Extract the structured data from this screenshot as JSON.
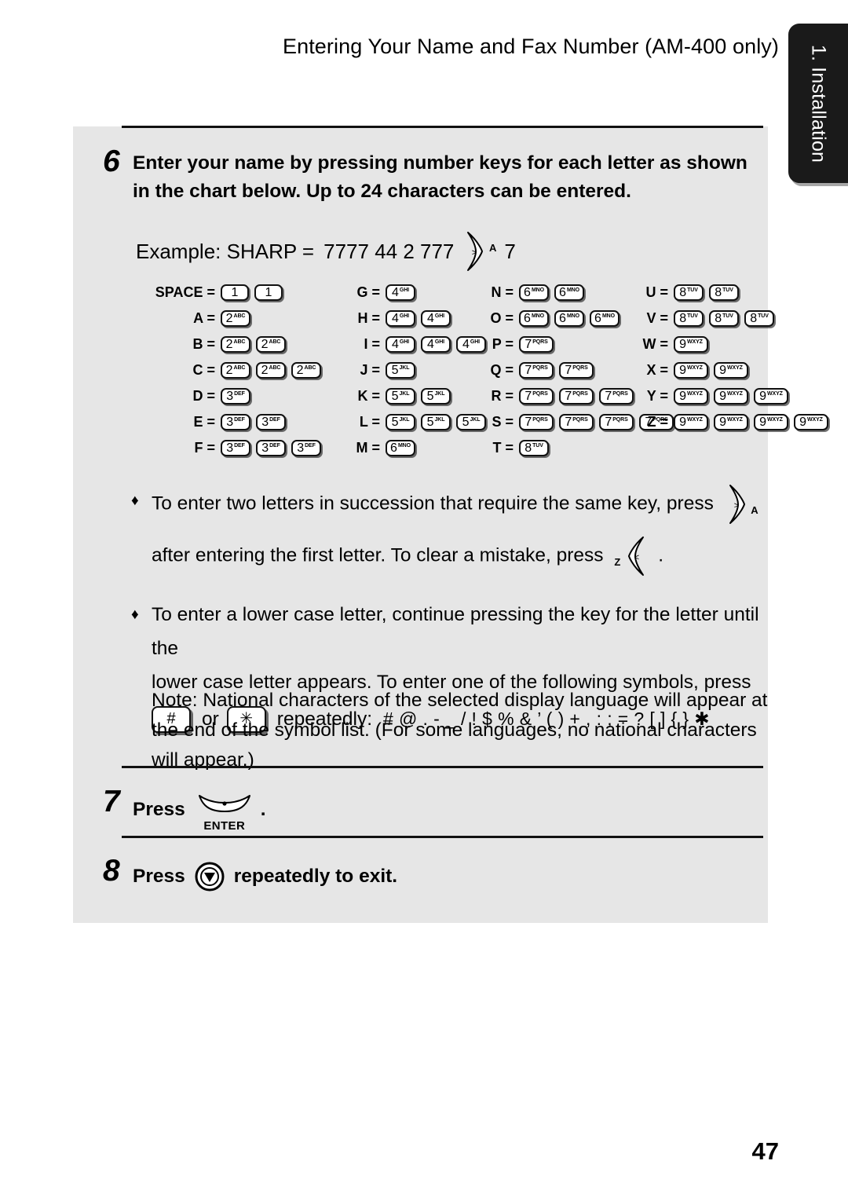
{
  "header": {
    "title": "Entering Your Name and Fax Number (AM-400 only)"
  },
  "side_tab": {
    "label": "1. Installation"
  },
  "steps": [
    {
      "number": "6",
      "text": "Enter your name by pressing number keys for each letter as shown in the chart below. Up to 24 characters can be entered."
    },
    {
      "number": "7",
      "press_label": "Press",
      "key_label": "ENTER",
      "trailing": "."
    },
    {
      "number": "8",
      "press_label": "Press",
      "after_text": "repeatedly to exit."
    }
  ],
  "example": {
    "prefix": "Example: SHARP =",
    "digits": "7777  44  2  777",
    "key_sup": "A",
    "suffix": "7"
  },
  "chart": {
    "columns": [
      {
        "rows": [
          {
            "label": "SPACE =",
            "keys": [
              {
                "digit": "1",
                "letters": ""
              },
              {
                "digit": "1",
                "letters": ""
              }
            ]
          },
          {
            "label": "A =",
            "keys": [
              {
                "digit": "2",
                "letters": "ABC"
              }
            ]
          },
          {
            "label": "B =",
            "keys": [
              {
                "digit": "2",
                "letters": "ABC"
              },
              {
                "digit": "2",
                "letters": "ABC"
              }
            ]
          },
          {
            "label": "C =",
            "keys": [
              {
                "digit": "2",
                "letters": "ABC"
              },
              {
                "digit": "2",
                "letters": "ABC"
              },
              {
                "digit": "2",
                "letters": "ABC"
              }
            ]
          },
          {
            "label": "D =",
            "keys": [
              {
                "digit": "3",
                "letters": "DEF"
              }
            ]
          },
          {
            "label": "E =",
            "keys": [
              {
                "digit": "3",
                "letters": "DEF"
              },
              {
                "digit": "3",
                "letters": "DEF"
              }
            ]
          },
          {
            "label": "F =",
            "keys": [
              {
                "digit": "3",
                "letters": "DEF"
              },
              {
                "digit": "3",
                "letters": "DEF"
              },
              {
                "digit": "3",
                "letters": "DEF"
              }
            ]
          }
        ]
      },
      {
        "rows": [
          {
            "label": "G =",
            "keys": [
              {
                "digit": "4",
                "letters": "GHI"
              }
            ]
          },
          {
            "label": "H =",
            "keys": [
              {
                "digit": "4",
                "letters": "GHI"
              },
              {
                "digit": "4",
                "letters": "GHI"
              }
            ]
          },
          {
            "label": "I =",
            "keys": [
              {
                "digit": "4",
                "letters": "GHI"
              },
              {
                "digit": "4",
                "letters": "GHI"
              },
              {
                "digit": "4",
                "letters": "GHI"
              }
            ]
          },
          {
            "label": "J =",
            "keys": [
              {
                "digit": "5",
                "letters": "JKL"
              }
            ]
          },
          {
            "label": "K =",
            "keys": [
              {
                "digit": "5",
                "letters": "JKL"
              },
              {
                "digit": "5",
                "letters": "JKL"
              }
            ]
          },
          {
            "label": "L =",
            "keys": [
              {
                "digit": "5",
                "letters": "JKL"
              },
              {
                "digit": "5",
                "letters": "JKL"
              },
              {
                "digit": "5",
                "letters": "JKL"
              }
            ]
          },
          {
            "label": "M =",
            "keys": [
              {
                "digit": "6",
                "letters": "MNO"
              }
            ]
          }
        ]
      },
      {
        "rows": [
          {
            "label": "N =",
            "keys": [
              {
                "digit": "6",
                "letters": "MNO"
              },
              {
                "digit": "6",
                "letters": "MNO"
              }
            ]
          },
          {
            "label": "O =",
            "keys": [
              {
                "digit": "6",
                "letters": "MNO"
              },
              {
                "digit": "6",
                "letters": "MNO"
              },
              {
                "digit": "6",
                "letters": "MNO"
              }
            ]
          },
          {
            "label": "P =",
            "keys": [
              {
                "digit": "7",
                "letters": "PQRS"
              }
            ]
          },
          {
            "label": "Q =",
            "keys": [
              {
                "digit": "7",
                "letters": "PQRS"
              },
              {
                "digit": "7",
                "letters": "PQRS"
              }
            ]
          },
          {
            "label": "R =",
            "keys": [
              {
                "digit": "7",
                "letters": "PQRS"
              },
              {
                "digit": "7",
                "letters": "PQRS"
              },
              {
                "digit": "7",
                "letters": "PQRS"
              }
            ]
          },
          {
            "label": "S =",
            "keys": [
              {
                "digit": "7",
                "letters": "PQRS"
              },
              {
                "digit": "7",
                "letters": "PQRS"
              },
              {
                "digit": "7",
                "letters": "PQRS"
              },
              {
                "digit": "7",
                "letters": "PQRS"
              }
            ]
          },
          {
            "label": "T =",
            "keys": [
              {
                "digit": "8",
                "letters": "TUV"
              }
            ]
          }
        ]
      },
      {
        "rows": [
          {
            "label": "U =",
            "keys": [
              {
                "digit": "8",
                "letters": "TUV"
              },
              {
                "digit": "8",
                "letters": "TUV"
              }
            ]
          },
          {
            "label": "V =",
            "keys": [
              {
                "digit": "8",
                "letters": "TUV"
              },
              {
                "digit": "8",
                "letters": "TUV"
              },
              {
                "digit": "8",
                "letters": "TUV"
              }
            ]
          },
          {
            "label": "W =",
            "keys": [
              {
                "digit": "9",
                "letters": "WXYZ"
              }
            ]
          },
          {
            "label": "X =",
            "keys": [
              {
                "digit": "9",
                "letters": "WXYZ"
              },
              {
                "digit": "9",
                "letters": "WXYZ"
              }
            ]
          },
          {
            "label": "Y =",
            "keys": [
              {
                "digit": "9",
                "letters": "WXYZ"
              },
              {
                "digit": "9",
                "letters": "WXYZ"
              },
              {
                "digit": "9",
                "letters": "WXYZ"
              }
            ]
          },
          {
            "label": "Z =",
            "keys": [
              {
                "digit": "9",
                "letters": "WXYZ"
              },
              {
                "digit": "9",
                "letters": "WXYZ"
              },
              {
                "digit": "9",
                "letters": "WXYZ"
              },
              {
                "digit": "9",
                "letters": "WXYZ"
              }
            ]
          }
        ]
      }
    ]
  },
  "bullets": {
    "mark": "♦",
    "one": {
      "line1_before": "To enter two letters in succession that require the same key, press",
      "right_key_sup": "A",
      "line2_before": "after entering the first letter. To clear a mistake, press",
      "left_key_sup": "Z",
      "line2_after": "."
    },
    "two": {
      "line1": "To enter a lower case letter, continue pressing the key for the letter until the",
      "line2": "lower case letter appears. To enter one of the following symbols, press",
      "hash_key": "#",
      "or_word": "or",
      "star_key": "✳",
      "repeatedly": "repeatedly:",
      "symbols": "# @ . - _ / ! $ % & ’ ( ) + , : ; = ? [ ] { } ✱"
    }
  },
  "note": "Note: National characters of the selected display language will appear at the end of the symbol list. (For some languages, no national characters will appear.)",
  "page_number": "47"
}
